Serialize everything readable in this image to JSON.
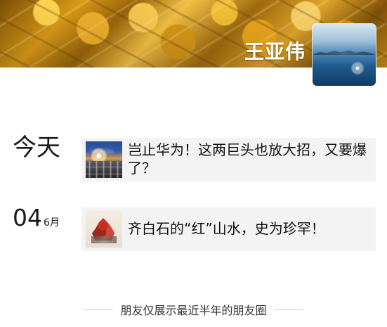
{
  "profile": {
    "name": "王亚伟"
  },
  "timeline": {
    "entries": [
      {
        "date_label": "今天",
        "text": "岂止华为！这两巨头也放大招，又要爆了？"
      },
      {
        "date_day": "04",
        "date_month": "6月",
        "text": "齐白石的“红”山水，史为珍罕！"
      }
    ]
  },
  "footer": {
    "text": "朋友仅展示最近半年的朋友圈"
  }
}
